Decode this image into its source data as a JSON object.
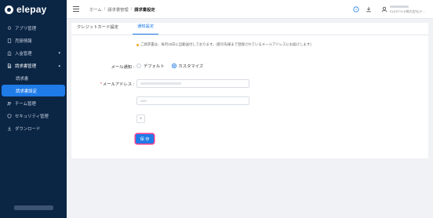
{
  "brand": {
    "name": "elepay"
  },
  "sidebar": {
    "items": [
      {
        "label": "アプリ管理",
        "icon": "rocket-icon"
      },
      {
        "label": "売掛情報",
        "icon": "receipt-icon"
      },
      {
        "label": "入金管理",
        "icon": "bank-icon",
        "chevron": "▾"
      },
      {
        "label": "請求書管理",
        "icon": "invoice-icon",
        "chevron": "▴"
      },
      {
        "label": "チーム管理",
        "icon": "team-icon"
      },
      {
        "label": "セキュリティ管理",
        "icon": "shield-icon"
      },
      {
        "label": "ダウンロード",
        "icon": "download-icon"
      }
    ],
    "sub_items": [
      {
        "label": "請求書"
      },
      {
        "label": "請求書設定",
        "active": true
      }
    ]
  },
  "header": {
    "breadcrumb": [
      "ホーム",
      "請求書管理",
      "請求書設定"
    ],
    "separator": "/",
    "user_company": "ELESTYLE株式会社(テ..."
  },
  "tabs": [
    {
      "label": "クレジットカード設定"
    },
    {
      "label": "通知設定",
      "active": true
    }
  ],
  "form": {
    "note": "ご請求書は、毎月15日に自動送付しております。(取引先様まで登録されているメールアドレスにお届けします)",
    "notification_label": "メール通知 :",
    "notification_options": [
      "デフォルト",
      "カスタマイズ"
    ],
    "notification_selected": "カスタマイズ",
    "email_label": "メールアドレス :",
    "email_required_mark": "*",
    "email2_value": "aaa",
    "add_label": "+",
    "save_label": "保 存"
  },
  "colors": {
    "sidebar_bg": "#0b2545",
    "accent": "#1e7be8",
    "highlight": "#ff3b8d"
  }
}
